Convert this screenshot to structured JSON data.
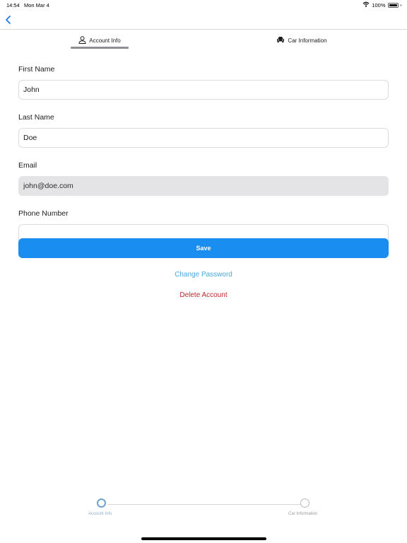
{
  "status_bar": {
    "time": "14:54",
    "date": "Mon Mar 4",
    "battery": "100%",
    "icons": [
      "wifi-icon",
      "battery-icon"
    ]
  },
  "nav": {
    "back_icon": "chevron-left-icon"
  },
  "tabs": [
    {
      "label": "Account Info",
      "icon": "person-icon",
      "active": true
    },
    {
      "label": "Car Information",
      "icon": "car-icon",
      "active": false
    }
  ],
  "form": {
    "first_name": {
      "label": "First Name",
      "value": "John"
    },
    "last_name": {
      "label": "Last Name",
      "value": "Doe"
    },
    "email": {
      "label": "Email",
      "value": "john@doe.com",
      "disabled": true
    },
    "phone": {
      "label": "Phone Number",
      "value": ""
    }
  },
  "actions": {
    "save": "Save",
    "change_password": "Change Password",
    "delete_account": "Delete Account"
  },
  "stepper": {
    "steps": [
      "Account Info",
      "Car Information"
    ],
    "current_step": 1
  },
  "colors": {
    "primary": "#1a8df0",
    "link": "#4aa8e0",
    "danger": "#c0282f",
    "disabled_bg": "#e4e4e6"
  }
}
